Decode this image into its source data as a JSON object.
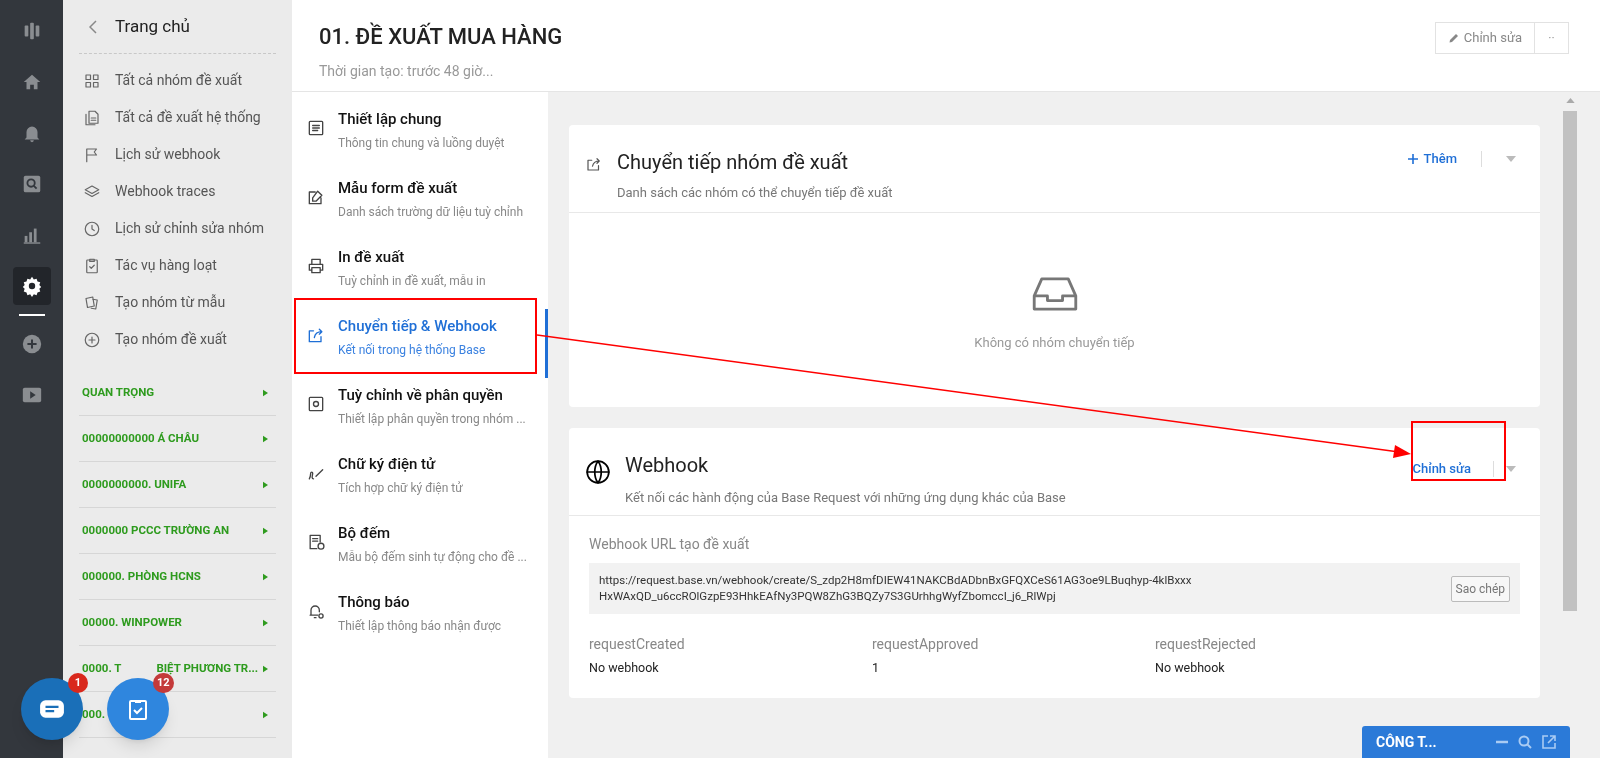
{
  "sidebar": {
    "back_title": "Trang chủ",
    "items": [
      {
        "label": "Tất cả nhóm đề xuất"
      },
      {
        "label": "Tất cả đề xuất hệ thống"
      },
      {
        "label": "Lịch sử webhook"
      },
      {
        "label": "Webhook traces"
      },
      {
        "label": "Lịch sử chỉnh sửa nhóm"
      },
      {
        "label": "Tác vụ hàng loạt"
      },
      {
        "label": "Tạo nhóm từ mẫu"
      },
      {
        "label": "Tạo nhóm đề xuất"
      }
    ],
    "groups": [
      {
        "parts": [
          "QUAN TRỌNG"
        ]
      },
      {
        "parts": [
          "00000000000 Á CHÂU"
        ]
      },
      {
        "parts": [
          "0000000000. UNIFA"
        ]
      },
      {
        "parts": [
          "0000000 PCCC TRƯỜNG AN"
        ]
      },
      {
        "parts": [
          "000000. PHÒNG HCNS"
        ]
      },
      {
        "parts": [
          "00000. WINPOWER"
        ]
      },
      {
        "parts": [
          "0000. T",
          "BIỆT PHƯƠNG TR..."
        ]
      },
      {
        "parts": [
          "000."
        ]
      }
    ]
  },
  "rail": [
    {
      "selected": false
    },
    {
      "selected": false
    },
    {
      "selected": false
    },
    {
      "selected": false
    },
    {
      "selected": false
    },
    {
      "selected": true
    },
    {
      "selected": false
    },
    {
      "selected": false
    }
  ],
  "header": {
    "title": "01. ĐỀ XUẤT MUA HÀNG",
    "subtitle": "Thời gian tạo: trước 48 giờ...",
    "edit_button": "Chỉnh sửa",
    "more_button": "··"
  },
  "settings_menu": [
    {
      "title": "Thiết lập chung",
      "desc": "Thông tin chung và luồng duyệt",
      "selected": false
    },
    {
      "title": "Mẫu form đề xuất",
      "desc": "Danh sách trường dữ liệu tuỳ chỉnh",
      "selected": false
    },
    {
      "title": "In đề xuất",
      "desc": "Tuỳ chỉnh in đề xuất, mẫu in",
      "selected": false
    },
    {
      "title": "Chuyển tiếp & Webhook",
      "desc": "Kết nối trong hệ thống Base",
      "selected": true
    },
    {
      "title": "Tuỳ chỉnh về phân quyền",
      "desc": "Thiết lập phân quyền trong nhóm ...",
      "selected": false
    },
    {
      "title": "Chữ ký điện tử",
      "desc": "Tích hợp chữ ký điện tử",
      "selected": false
    },
    {
      "title": "Bộ đếm",
      "desc": "Mẫu bộ đếm sinh tự động cho đề ...",
      "selected": false
    },
    {
      "title": "Thông báo",
      "desc": "Thiết lập thông báo nhận được",
      "selected": false
    }
  ],
  "forward_card": {
    "title": "Chuyển tiếp nhóm đề xuất",
    "subtitle": "Danh sách các nhóm có thể chuyển tiếp đề xuất",
    "add_button": "Thêm",
    "empty_text": "Không có nhóm chuyển tiếp"
  },
  "webhook_card": {
    "title": "Webhook",
    "subtitle": "Kết nối các hành động của Base Request với những ứng dụng khác của Base",
    "edit_button": "Chỉnh sửa",
    "url_label": "Webhook URL tạo đề xuất",
    "url": "https://request.base.vn/webhook/create/S_zdp2H8mfDIEW41NAKCBdADbnBxGFQXCeS61AG3oe9LBuqhyp-4klBxxxHxWAxQD_u6ccROlGzpE93HhkEAfNy3PQW8ZhG3BQZy7S3GUrhhgWyfZbomccI_j6_RlWpj",
    "copy_button": "Sao chép",
    "events": [
      {
        "name": "requestCreated",
        "value": "No webhook"
      },
      {
        "name": "requestApproved",
        "value": "1"
      },
      {
        "name": "requestRejected",
        "value": "No webhook"
      }
    ]
  },
  "chat_widget": {
    "title": "CÔNG T..."
  },
  "fab": [
    {
      "badge": "1"
    },
    {
      "badge": "12"
    }
  ]
}
